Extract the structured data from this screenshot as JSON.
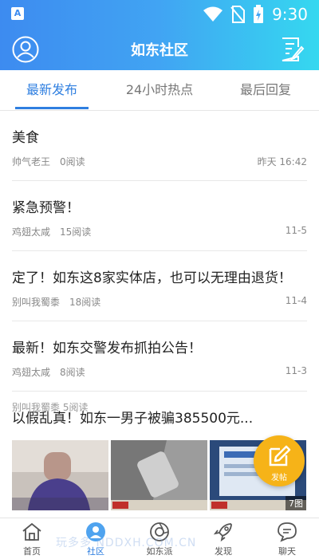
{
  "status": {
    "time": "9:30",
    "app_letter": "A"
  },
  "header": {
    "title": "如东社区"
  },
  "tabs": [
    {
      "label": "最新发布"
    },
    {
      "label": "24小时热点"
    },
    {
      "label": "最后回复"
    }
  ],
  "posts": [
    {
      "title": "美食",
      "author": "帅气老王",
      "reads": "0阅读",
      "date": "昨天 16:42"
    },
    {
      "title": "紧急预警！",
      "author": "鸡翅太咸",
      "reads": "15阅读",
      "date": "11-5"
    },
    {
      "title": "定了！如东这8家实体店，也可以无理由退货！",
      "author": "别叫我蜀黍",
      "reads": "18阅读",
      "date": "11-4"
    },
    {
      "title": "最新！如东交警发布抓拍公告！",
      "author": "鸡翅太咸",
      "reads": "8阅读",
      "date": "11-3"
    },
    {
      "title": "以假乱真！如东一男子被骗385500元...",
      "image_count": "7图",
      "partial_meta": "别叫我蜀黍  5阅读"
    }
  ],
  "fab": {
    "label": "发帖"
  },
  "nav": [
    {
      "label": "首页"
    },
    {
      "label": "社区"
    },
    {
      "label": "如东派"
    },
    {
      "label": "发现"
    },
    {
      "label": "聊天"
    }
  ],
  "watermark": "玩多多  NDDXH.COM.CN",
  "colors": {
    "accent": "#2f7fe0",
    "header_start": "#3d8bf0",
    "header_end": "#35d8f0",
    "fab": "#f6b318"
  }
}
